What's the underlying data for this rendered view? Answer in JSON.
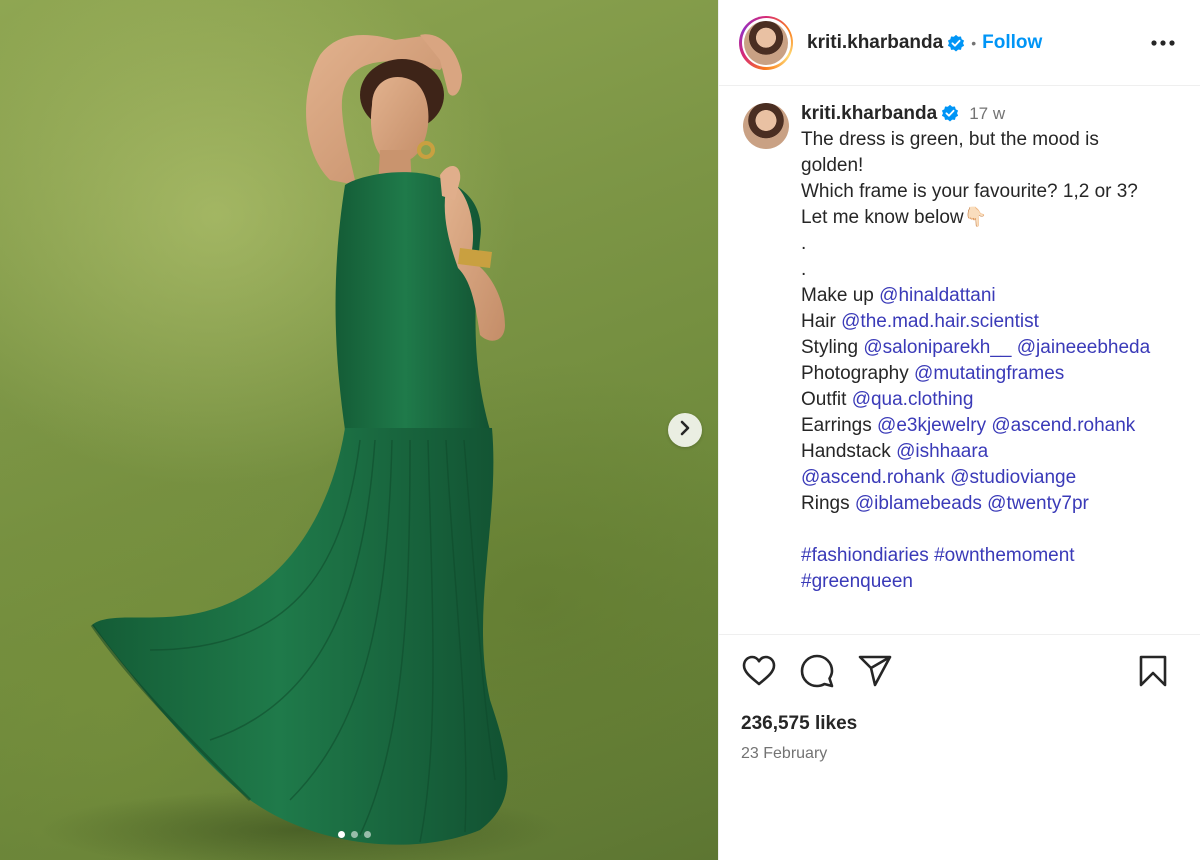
{
  "post": {
    "username": "kriti.kharbanda",
    "verified": true,
    "follow_label": "Follow",
    "separator": "•",
    "more_label": "More options"
  },
  "media": {
    "description_icon": "photo",
    "slide_count": 3,
    "active_slide": 1
  },
  "caption": {
    "username": "kriti.kharbanda",
    "time_ago": "17 w",
    "lines": [
      {
        "text": "The dress is green, but the mood is"
      },
      {
        "text": "golden!"
      },
      {
        "text": "Which frame is your favourite? 1,2 or 3?"
      },
      {
        "text": "Let me know below👇🏻"
      },
      {
        "text": "."
      },
      {
        "text": "."
      }
    ],
    "credits": [
      {
        "label": "Make up",
        "mentions": [
          "@hinaldattani"
        ]
      },
      {
        "label": "Hair",
        "mentions": [
          "@the.mad.hair.scientist"
        ]
      },
      {
        "label": "Styling",
        "mentions": [
          "@saloniparekh__",
          "@jaineeebheda"
        ]
      },
      {
        "label": "Photography",
        "mentions": [
          "@mutatingframes"
        ]
      },
      {
        "label": "Outfit",
        "mentions": [
          "@qua.clothing"
        ]
      },
      {
        "label": "Earrings",
        "mentions": [
          "@e3kjewelry",
          "@ascend.rohank"
        ]
      },
      {
        "label": "Handstack",
        "mentions": [
          "@ishhaara"
        ]
      },
      {
        "label": "",
        "mentions": [
          "@ascend.rohank",
          "@studioviange"
        ]
      },
      {
        "label": "Rings",
        "mentions": [
          "@iblamebeads",
          "@twenty7pr"
        ]
      }
    ],
    "hashtags_line1": [
      "#fashiondiaries",
      "#ownthemoment"
    ],
    "hashtags_line2": [
      "#greenqueen"
    ]
  },
  "actions": {
    "like_icon": "heart-icon",
    "comment_icon": "comment-icon",
    "share_icon": "send-icon",
    "save_icon": "bookmark-icon"
  },
  "stats": {
    "likes": "236,575 likes",
    "date": "23 February"
  },
  "colors": {
    "link": "#3a3ab8",
    "follow": "#0095f6",
    "verified": "#0095f6",
    "dress": "#1f7a4a",
    "backdrop": "#7d9646"
  }
}
